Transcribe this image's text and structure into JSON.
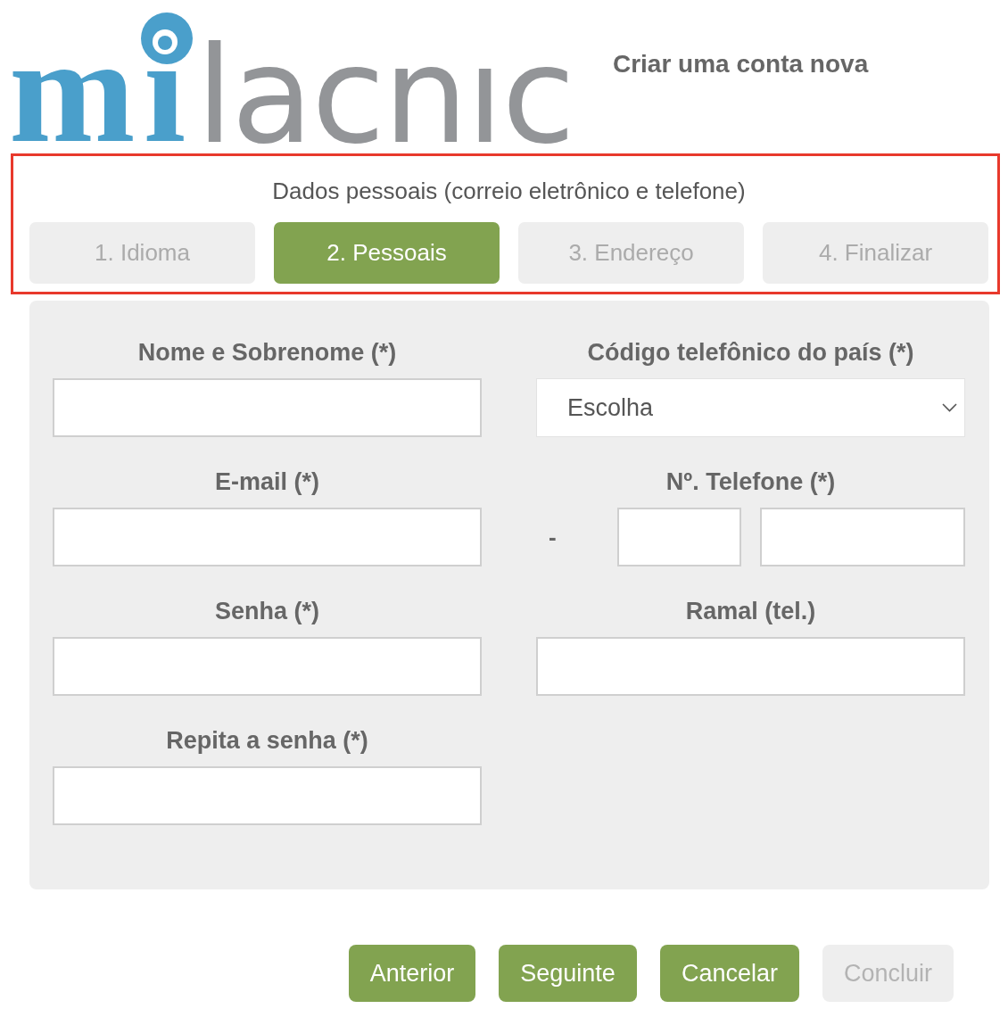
{
  "logo": {
    "letter_m": "m",
    "letter_i": "ı",
    "wordmark": "lacnıc"
  },
  "page_title": "Criar uma conta nova",
  "wizard": {
    "heading": "Dados pessoais (correio eletrônico e telefone)",
    "steps": [
      {
        "label": "1. Idioma",
        "selected": false
      },
      {
        "label": "2. Pessoais",
        "selected": true
      },
      {
        "label": "3. Endereço",
        "selected": false
      },
      {
        "label": "4. Finalizar",
        "selected": false
      }
    ]
  },
  "form": {
    "left_column": [
      {
        "label": "Nome e Sobrenome (*)",
        "kind": "text"
      },
      {
        "label": "E-mail (*)",
        "kind": "text"
      },
      {
        "label": "Senha (*)",
        "kind": "text"
      },
      {
        "label": "Repita a senha (*)",
        "kind": "text"
      }
    ],
    "right_column": [
      {
        "label": "Código telefônico do país (*)",
        "kind": "select",
        "value": "Escolha"
      },
      {
        "label": "Nº. Telefone (*)",
        "kind": "phone",
        "separator": "-"
      },
      {
        "label": "Ramal (tel.)",
        "kind": "text"
      }
    ]
  },
  "buttons": [
    {
      "label": "Anterior",
      "disabled": false
    },
    {
      "label": "Seguinte",
      "disabled": false
    },
    {
      "label": "Cancelar",
      "disabled": false
    },
    {
      "label": "Concluir",
      "disabled": true
    }
  ]
}
